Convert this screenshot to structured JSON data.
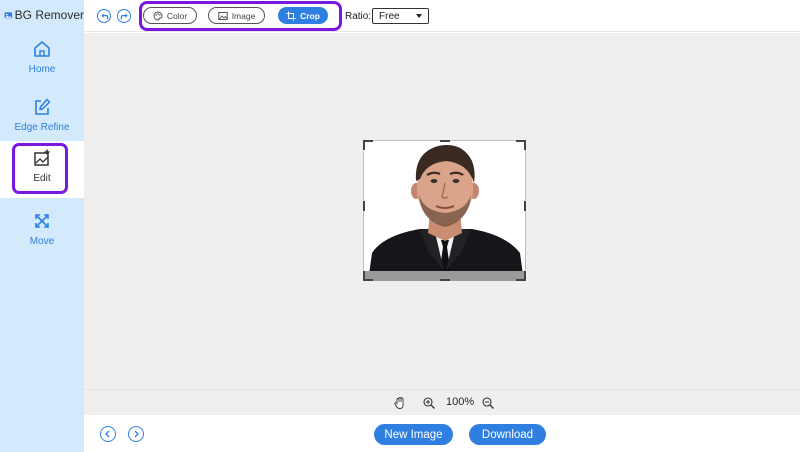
{
  "app": {
    "title": "BG Remover"
  },
  "sidebar": {
    "items": [
      {
        "label": "Home",
        "icon": "home-icon"
      },
      {
        "label": "Edge Refine",
        "icon": "edge-refine-icon"
      },
      {
        "label": "Edit",
        "icon": "image-edit-icon",
        "active": true
      },
      {
        "label": "Move",
        "icon": "move-arrows-icon"
      }
    ]
  },
  "toolbar": {
    "tools": [
      {
        "label": "Color",
        "icon": "palette-icon"
      },
      {
        "label": "Image",
        "icon": "image-icon"
      },
      {
        "label": "Crop",
        "icon": "crop-icon",
        "active": true
      }
    ],
    "ratio_label": "Ratio:",
    "ratio_value": "Free"
  },
  "zoom": {
    "level": "100%"
  },
  "footer": {
    "new_image_label": "New Image",
    "download_label": "Download"
  },
  "colors": {
    "accent": "#2f7fe0",
    "highlight": "#7b18e0",
    "sidebar_bg": "#d2eafc",
    "canvas_bg": "#efefef"
  }
}
